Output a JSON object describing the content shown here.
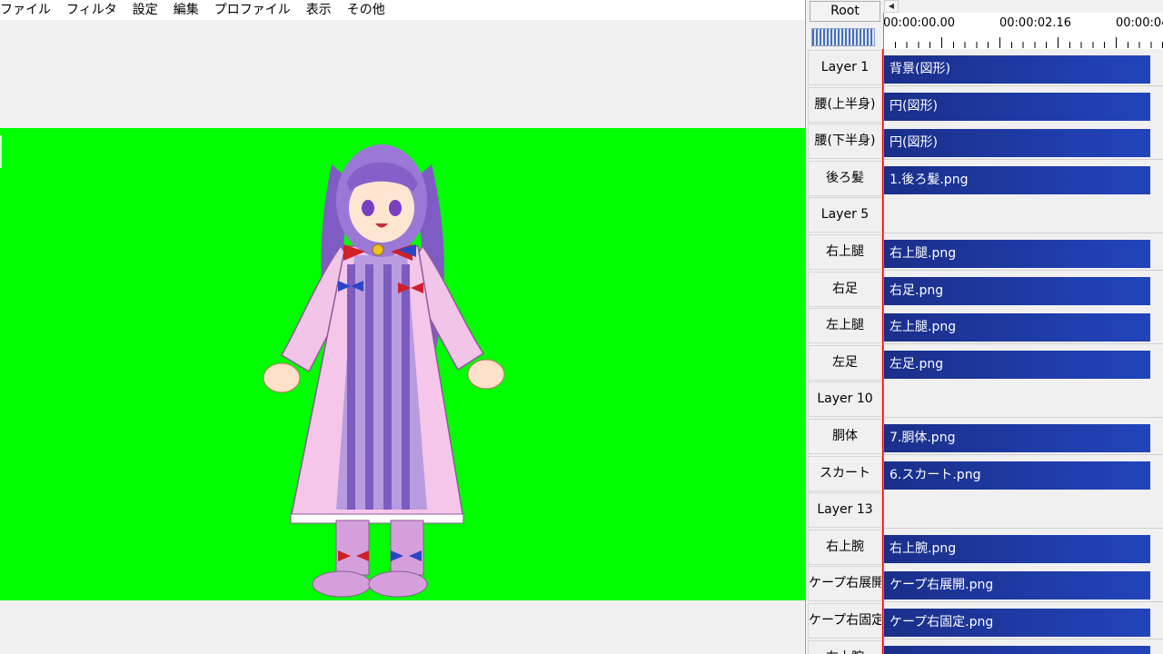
{
  "menu": {
    "items": [
      "ファイル",
      "フィルタ",
      "設定",
      "編集",
      "プロファイル",
      "表示",
      "その他"
    ]
  },
  "canvas": {
    "background_color": "#00ff00"
  },
  "timeline": {
    "root_label": "Root",
    "scroll_left_arrow": "◀",
    "ruler_labels": [
      "00:00:00.00",
      "00:00:02.16",
      "00:00:04"
    ],
    "rows": [
      {
        "layer": "Layer  1",
        "clip": "背景(図形)"
      },
      {
        "layer": "腰(上半身)",
        "clip": "円(図形)"
      },
      {
        "layer": "腰(下半身)",
        "clip": "円(図形)"
      },
      {
        "layer": "後ろ髪",
        "clip": "1.後ろ髪.png"
      },
      {
        "layer": "Layer  5",
        "clip": ""
      },
      {
        "layer": "右上腿",
        "clip": "右上腿.png"
      },
      {
        "layer": "右足",
        "clip": "右足.png"
      },
      {
        "layer": "左上腿",
        "clip": "左上腿.png"
      },
      {
        "layer": "左足",
        "clip": "左足.png"
      },
      {
        "layer": "Layer 10",
        "clip": ""
      },
      {
        "layer": "胴体",
        "clip": "7.胴体.png"
      },
      {
        "layer": "スカート",
        "clip": "6.スカート.png"
      },
      {
        "layer": "Layer 13",
        "clip": ""
      },
      {
        "layer": "右上腕",
        "clip": "右上腕.png"
      },
      {
        "layer": "ケープ右展開",
        "clip": "ケープ右展開.png"
      },
      {
        "layer": "ケープ右固定",
        "clip": "ケープ右固定.png"
      },
      {
        "layer": "右上腕",
        "clip": ""
      }
    ],
    "clip_color": "#1f3a9f"
  }
}
